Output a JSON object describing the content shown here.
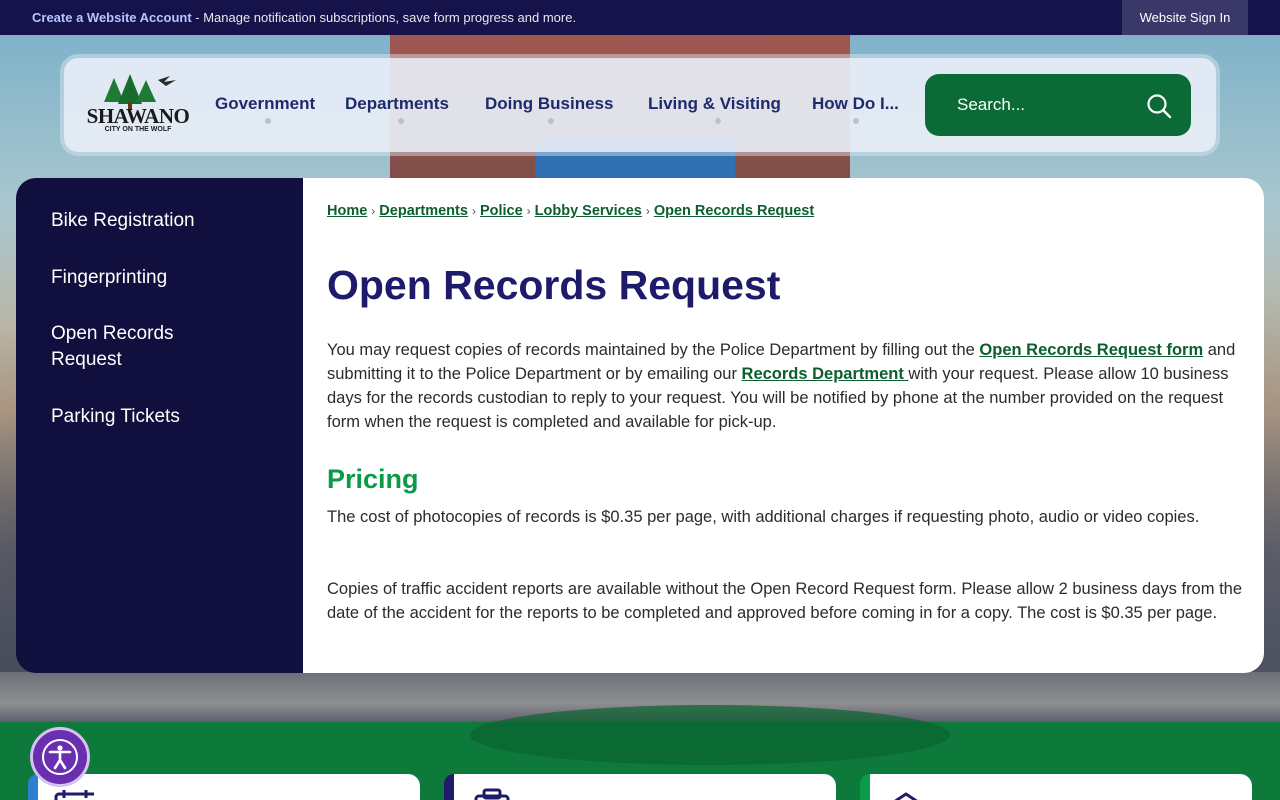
{
  "topbar": {
    "create_account_label": "Create a Website Account",
    "create_account_desc": " - Manage notification subscriptions, save form progress and more.",
    "sign_in_label": "Website Sign In"
  },
  "logo": {
    "name": "SHAWANO",
    "tagline": "CITY ON THE WOLF"
  },
  "nav": {
    "items": [
      {
        "label": "Government"
      },
      {
        "label": "Departments"
      },
      {
        "label": "Doing Business"
      },
      {
        "label": "Living & Visiting"
      },
      {
        "label": "How Do I..."
      }
    ]
  },
  "search": {
    "placeholder": "Search..."
  },
  "sidebar": {
    "items": [
      {
        "label": "Bike Registration"
      },
      {
        "label": "Fingerprinting"
      },
      {
        "label": "Open Records Request"
      },
      {
        "label": "Parking Tickets"
      }
    ]
  },
  "breadcrumb": {
    "items": [
      "Home",
      "Departments",
      "Police",
      "Lobby Services",
      "Open Records Request"
    ],
    "separator": "›"
  },
  "main": {
    "title": "Open Records Request",
    "intro_1": "You may request copies of records maintained by the Police Department by filling out the ",
    "intro_link_1": "Open Records Request form",
    "intro_2": " and submitting it to the Police Department or by emailing our ",
    "intro_link_2": "Records Department ",
    "intro_3": "with your request. Please allow 10 business days for the records custodian to reply to your request. You will be notified by phone at the number provided on the request form when the request is completed and available for pick-up.",
    "pricing_heading": "Pricing",
    "pricing_text": "The cost of photocopies of records is $0.35 per page, with additional charges if requesting photo, audio or video copies.",
    "traffic_text": "Copies of traffic accident reports are available without the Open Record Request form. Please allow 2 business days from the date of the accident for the reports to be completed and approved before coming in for a copy. The cost is $0.35 per page."
  },
  "colors": {
    "navy": "#16124a",
    "green": "#0b6b36",
    "title": "#1f1b6b",
    "heading_green": "#0a9a48"
  }
}
